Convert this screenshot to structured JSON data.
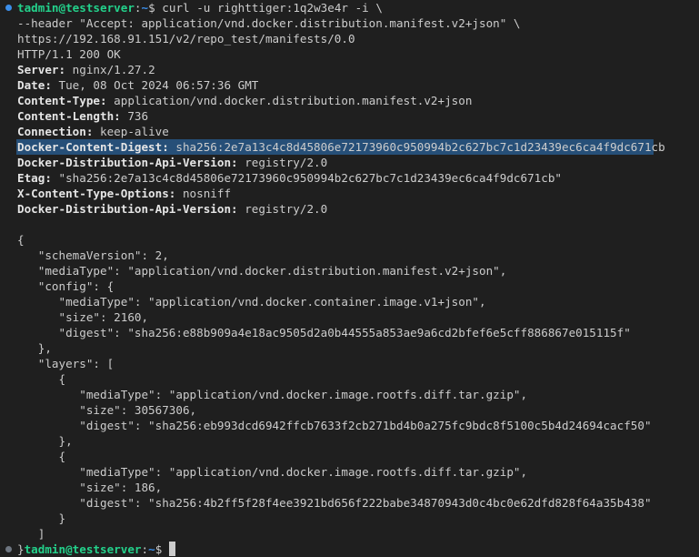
{
  "prompt": {
    "user_host": "tadmin@testserver",
    "path": "~",
    "symbol": "$"
  },
  "command": {
    "line1": "curl -u righttiger:1q2w3e4r -i \\",
    "line2": "--header \"Accept: application/vnd.docker.distribution.manifest.v2+json\" \\",
    "line3": "https://192.168.91.151/v2/repo_test/manifests/0.0"
  },
  "response": {
    "status": "HTTP/1.1 200 OK",
    "headers": [
      {
        "name": "Server:",
        "value": " nginx/1.27.2"
      },
      {
        "name": "Date:",
        "value": " Tue, 08 Oct 2024 06:57:36 GMT"
      },
      {
        "name": "Content-Type:",
        "value": " application/vnd.docker.distribution.manifest.v2+json"
      },
      {
        "name": "Content-Length:",
        "value": " 736"
      },
      {
        "name": "Connection:",
        "value": " keep-alive"
      },
      {
        "name": "Docker-Content-Digest:",
        "value": " sha256:2e7a13c4c8d45806e72173960c950994b2c627bc7c1d23439ec6ca4f9dc671cb"
      },
      {
        "name": "Docker-Distribution-Api-Version:",
        "value": " registry/2.0"
      },
      {
        "name": "Etag:",
        "value": " \"sha256:2e7a13c4c8d45806e72173960c950994b2c627bc7c1d23439ec6ca4f9dc671cb\""
      },
      {
        "name": "X-Content-Type-Options:",
        "value": " nosniff"
      },
      {
        "name": "Docker-Distribution-Api-Version:",
        "value": " registry/2.0"
      }
    ]
  },
  "body_lines": [
    "{",
    "   \"schemaVersion\": 2,",
    "   \"mediaType\": \"application/vnd.docker.distribution.manifest.v2+json\",",
    "   \"config\": {",
    "      \"mediaType\": \"application/vnd.docker.container.image.v1+json\",",
    "      \"size\": 2160,",
    "      \"digest\": \"sha256:e88b909a4e18ac9505d2a0b44555a853ae9a6cd2bfef6e5cff886867e015115f\"",
    "   },",
    "   \"layers\": [",
    "      {",
    "         \"mediaType\": \"application/vnd.docker.image.rootfs.diff.tar.gzip\",",
    "         \"size\": 30567306,",
    "         \"digest\": \"sha256:eb993dcd6942ffcb7633f2cb271bd4b0a275fc9bdc8f5100c5b4d24694cacf50\"",
    "      },",
    "      {",
    "         \"mediaType\": \"application/vnd.docker.image.rootfs.diff.tar.gzip\",",
    "         \"size\": 186,",
    "         \"digest\": \"sha256:4b2ff5f28f4ee3921bd656f222babe34870943d0c4bc0e62dfd828f64a35b438\"",
    "      }",
    "   ]"
  ],
  "final_prompt_prefix": "}",
  "colors": {
    "background": "#1f1f1f",
    "text": "#cccccc",
    "user_host": "#23d18b",
    "path": "#3b8eea",
    "selection": "#264f78"
  }
}
